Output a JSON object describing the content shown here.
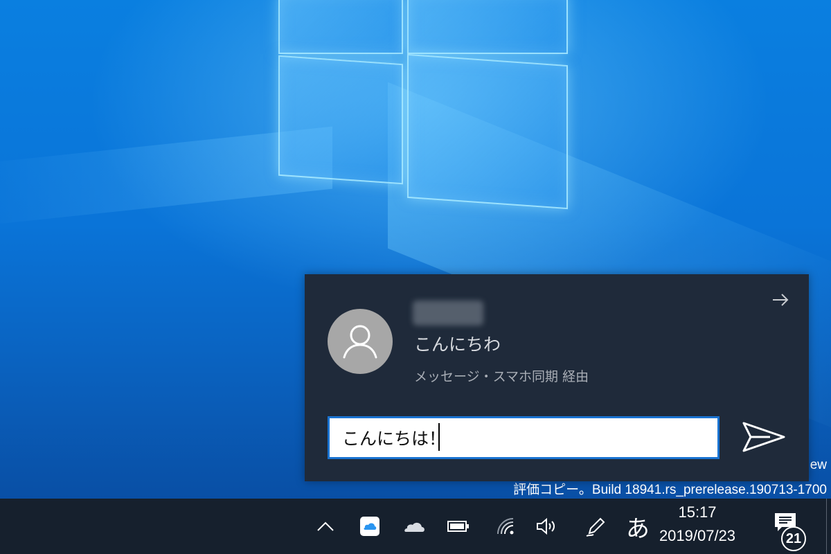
{
  "desktop": {
    "watermark_line1": "ew",
    "watermark_line2": "評価コピー。Build 18941.rs_prerelease.190713-1700"
  },
  "notification": {
    "message": "こんにちわ",
    "via": "メッセージ・スマホ同期 経由",
    "reply_value": "こんにちは！",
    "icons": {
      "avatar": "person-icon",
      "expand": "arrow-right-icon",
      "send": "send-icon"
    }
  },
  "taskbar": {
    "ime_mode": "あ",
    "time": "15:17",
    "date": "2019/07/23",
    "notification_count": "21",
    "icons": [
      "chevron-up-icon",
      "icloud-icon",
      "onedrive-icon",
      "battery-icon",
      "wifi-icon",
      "volume-icon",
      "pen-icon",
      "action-center-icon"
    ]
  },
  "colors": {
    "accent": "#1a73d1",
    "notification_bg": "#1f2a3a",
    "taskbar_bg": "#16202d",
    "desktop_blue": "#0a74d8"
  }
}
